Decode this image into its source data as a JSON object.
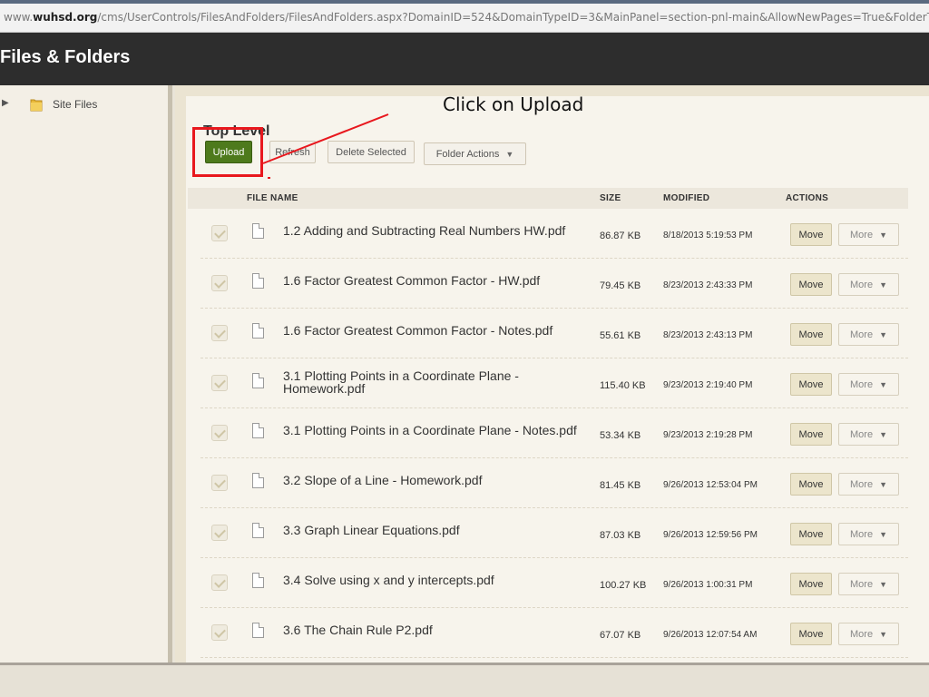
{
  "browser": {
    "url_prefix": "www.",
    "url_domain": "wuhsd.org",
    "url_rest": "/cms/UserControls/FilesAndFolders/FilesAndFolders.aspx?DomainID=524&DomainTypeID=3&MainPanel=section-pnl-main&AllowNewPages=True&FolderType=D"
  },
  "header": {
    "title": "Files & Folders"
  },
  "sidebar": {
    "items": [
      {
        "label": "Site Files",
        "icon": "folder-icon"
      }
    ]
  },
  "main": {
    "folder_title": "Top Level",
    "toolbar": {
      "upload": "Upload",
      "refresh": "Refresh",
      "delete_selected": "Delete Selected",
      "folder_actions": "Folder Actions"
    },
    "annotation": "Click on Upload",
    "columns": {
      "file_name": "FILE NAME",
      "size": "SIZE",
      "modified": "MODIFIED",
      "actions": "ACTIONS"
    },
    "row_actions": {
      "move": "Move",
      "more": "More"
    },
    "files": [
      {
        "name": "1.2 Adding and Subtracting Real Numbers HW.pdf",
        "size": "86.87 KB",
        "modified": "8/18/2013 5:19:53 PM"
      },
      {
        "name": "1.6 Factor Greatest Common Factor - HW.pdf",
        "size": "79.45 KB",
        "modified": "8/23/2013 2:43:33 PM"
      },
      {
        "name": "1.6 Factor Greatest Common Factor - Notes.pdf",
        "size": "55.61 KB",
        "modified": "8/23/2013 2:43:13 PM"
      },
      {
        "name": "3.1 Plotting Points in a Coordinate Plane - Homework.pdf",
        "size": "115.40 KB",
        "modified": "9/23/2013 2:19:40 PM"
      },
      {
        "name": "3.1 Plotting Points in a Coordinate Plane - Notes.pdf",
        "size": "53.34 KB",
        "modified": "9/23/2013 2:19:28 PM"
      },
      {
        "name": "3.2 Slope of a Line - Homework.pdf",
        "size": "81.45 KB",
        "modified": "9/26/2013 12:53:04 PM"
      },
      {
        "name": "3.3 Graph Linear Equations.pdf",
        "size": "87.03 KB",
        "modified": "9/26/2013 12:59:56 PM"
      },
      {
        "name": "3.4 Solve using x and y intercepts.pdf",
        "size": "100.27 KB",
        "modified": "9/26/2013 1:00:31 PM"
      },
      {
        "name": "3.6 The Chain Rule P2.pdf",
        "size": "67.07 KB",
        "modified": "9/26/2013 12:07:54 AM"
      }
    ]
  },
  "colors": {
    "header_bg": "#2d2d2d",
    "upload_green": "#4e7a1c",
    "annotation_red": "#e8181e"
  }
}
